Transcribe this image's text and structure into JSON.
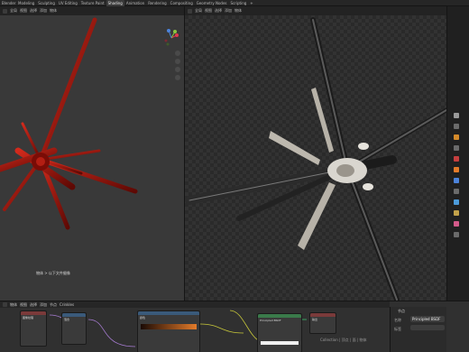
{
  "app": {
    "name": "Blender"
  },
  "workspace_tabs": [
    "Modeling",
    "Sculpting",
    "UV Editing",
    "Texture Paint",
    "Shading",
    "Animation",
    "Rendering",
    "Compositing",
    "Geometry Nodes",
    "Scripting",
    "+"
  ],
  "active_tab_index": 4,
  "viewport_left": {
    "header_items": [
      "全局",
      "视图",
      "选择",
      "添加",
      "物体"
    ],
    "status": "物体 > 以下文件摄像"
  },
  "viewport_right": {
    "header_items": [
      "全局",
      "视图",
      "选择",
      "添加",
      "物体"
    ]
  },
  "node_editor": {
    "header_items": [
      "物体",
      "视图",
      "选择",
      "添加",
      "节点",
      "Crinkles"
    ],
    "node_labels": [
      "Principled BSDF",
      "输出",
      "颜色",
      "混合",
      "图像纹理"
    ]
  },
  "properties": {
    "title": "节点",
    "name_label": "名称",
    "name_value": "Principled BSDF",
    "label_label": "标签"
  },
  "status_bar": {
    "text": "Collection | 顶点 | 面 | 物体"
  },
  "colors": {
    "rotor_left": "#a8140e",
    "accent_orange": "#e47b2a",
    "gizmo_x": "#e0394c",
    "gizmo_y": "#8cc540",
    "gizmo_z": "#4c83db"
  }
}
